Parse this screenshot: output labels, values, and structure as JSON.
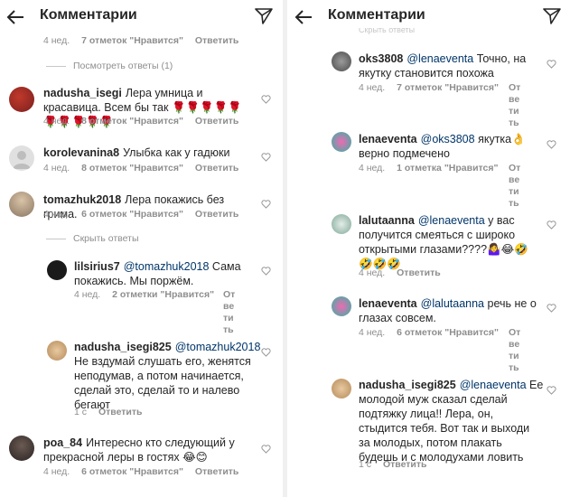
{
  "left": {
    "header": {
      "title": "Комментарии"
    },
    "top_meta": {
      "time": "4 нед.",
      "likes": "7 отметок \"Нравится\"",
      "reply": "Ответить"
    },
    "view_replies": "Посмотреть ответы (1)",
    "hide_replies": "Скрыть ответы",
    "comments": [
      {
        "user": "nadusha_isegi",
        "text": "Лера умница и красавица. Всем бы так 🌹🌹🌹🌹🌹🌹🌹🌹🌹🌹",
        "time": "4 нед.",
        "likes": "8 отметок \"Нравится\"",
        "reply": "Ответить"
      },
      {
        "user": "korolevanina8",
        "text": "Улыбка как у гадюки",
        "time": "4 нед.",
        "likes": "8 отметок \"Нравится\"",
        "reply": "Ответить"
      },
      {
        "user": "tomazhuk2018",
        "text": "Лера покажись без грима.",
        "time": "4 нед.",
        "likes": "6 отметок \"Нравится\"",
        "reply": "Ответить"
      },
      {
        "user": "lilsirius7",
        "mention": "@tomazhuk2018",
        "text": "Сама покажись. Мы поржём.",
        "time": "4 нед.",
        "likes": "2 отметки \"Нравится\"",
        "reply": "Ответить"
      },
      {
        "user": "nadusha_isegi825",
        "mention": "@tomazhuk2018",
        "text": "Не вздумай слушать его, женятся неподумав, а потом начинается, сделай это, сделай то и налево бегают",
        "time": "1 с",
        "reply": "Ответить"
      },
      {
        "user": "poa_84",
        "text": "Интересно кто следующий у прекрасной леры в гостях 😂😊",
        "time": "4 нед.",
        "likes": "6 отметок \"Нравится\"",
        "reply": "Ответить"
      }
    ]
  },
  "right": {
    "header": {
      "title": "Комментарии"
    },
    "top_cut": "Скрыть ответы",
    "comments": [
      {
        "user": "oks3808",
        "mention": "@lenaeventa",
        "text": "Точно, на якутку становится похожа",
        "time": "4 нед.",
        "likes": "7 отметок \"Нравится\"",
        "reply": "Ответить"
      },
      {
        "user": "lenaeventa",
        "mention": "@oks3808",
        "text": "якутка👌 верно подмечено",
        "time": "4 нед.",
        "likes": "1 отметка \"Нравится\"",
        "reply": "Ответить"
      },
      {
        "user": "lalutaanna",
        "mention": "@lenaeventa",
        "text": "у вас получится смеяться с широко открытыми глазами????🤷‍♀️😂🤣🤣🤣🤣",
        "time": "4 нед.",
        "reply": "Ответить"
      },
      {
        "user": "lenaeventa",
        "mention": "@lalutaanna",
        "text": "речь не о глазах совсем.",
        "time": "4 нед.",
        "likes": "6 отметок \"Нравится\"",
        "reply": "Ответить"
      },
      {
        "user": "nadusha_isegi825",
        "mention": "@lenaeventa",
        "text": "Ее молодой муж сказал сделай подтяжку лица!! Лера, он, стыдится тебя. Вот так и выходи за молодых, потом плакать будешь и с молодухами ловить",
        "time": "1 с",
        "reply": "Ответить"
      }
    ]
  }
}
